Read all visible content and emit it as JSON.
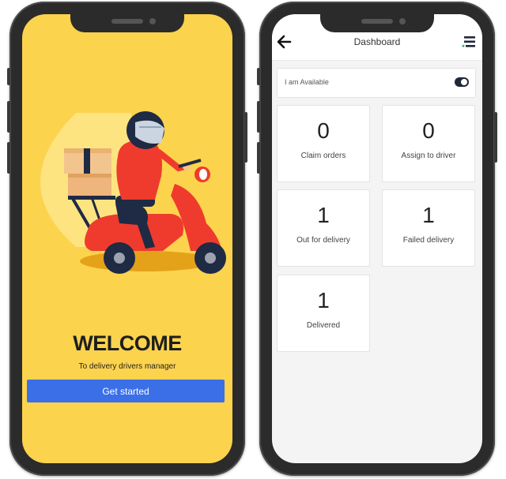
{
  "welcome": {
    "title": "WELCOME",
    "subtitle": "To delivery drivers manager",
    "button_label": "Get started",
    "colors": {
      "background": "#fcd34d",
      "button": "#3b6fe8",
      "scooter": "#ef3b2d"
    }
  },
  "dashboard": {
    "header": {
      "title": "Dashboard",
      "back_icon": "arrow-left-icon",
      "menu_icon": "menu-icon"
    },
    "availability": {
      "label": "I am Available",
      "toggle_on": true
    },
    "cards": [
      {
        "value": "0",
        "label": "Claim orders"
      },
      {
        "value": "0",
        "label": "Assign to driver"
      },
      {
        "value": "1",
        "label": "Out for delivery"
      },
      {
        "value": "1",
        "label": "Failed delivery"
      },
      {
        "value": "1",
        "label": "Delivered"
      }
    ]
  }
}
